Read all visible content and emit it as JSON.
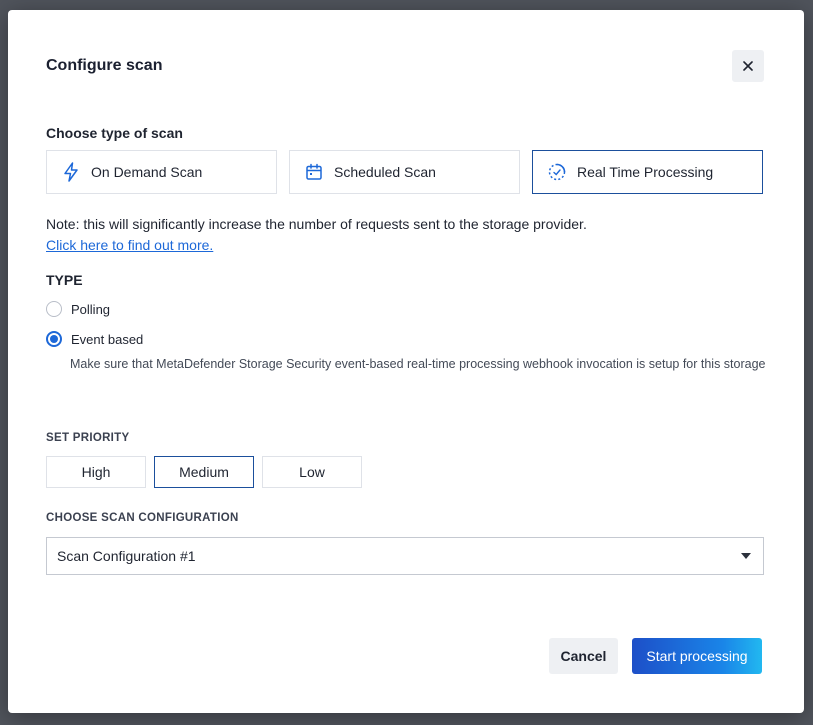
{
  "modal": {
    "title": "Configure scan",
    "close_icon": "close-icon"
  },
  "scan_type": {
    "label": "Choose type of scan",
    "options": [
      {
        "label": "On Demand Scan",
        "icon": "lightning-icon",
        "selected": false
      },
      {
        "label": "Scheduled Scan",
        "icon": "calendar-icon",
        "selected": false
      },
      {
        "label": "Real Time Processing",
        "icon": "realtime-spinner-icon",
        "selected": true
      }
    ]
  },
  "note": {
    "text": "Note: this will significantly increase the number of requests sent to the storage provider.",
    "link": "Click here to find out more."
  },
  "type": {
    "label": "TYPE",
    "options": [
      {
        "label": "Polling",
        "checked": false
      },
      {
        "label": "Event based",
        "checked": true
      }
    ],
    "helper": "Make sure that MetaDefender Storage Security event-based real-time processing webhook invocation is setup for this storage"
  },
  "priority": {
    "label": "SET PRIORITY",
    "options": [
      {
        "label": "High",
        "selected": false
      },
      {
        "label": "Medium",
        "selected": true
      },
      {
        "label": "Low",
        "selected": false
      }
    ]
  },
  "scan_config": {
    "label": "CHOOSE SCAN CONFIGURATION",
    "value": "Scan Configuration #1"
  },
  "footer": {
    "cancel": "Cancel",
    "submit": "Start processing"
  },
  "colors": {
    "accent": "#1d68d8",
    "selected_border": "#1b4f9c",
    "primary_gradient_start": "#1d4fc8",
    "primary_gradient_end": "#22b8f0"
  }
}
